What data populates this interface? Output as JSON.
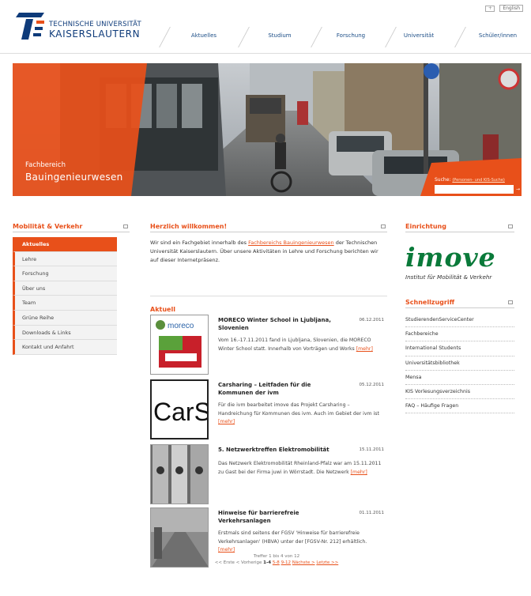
{
  "colors": {
    "accent": "#e8501a",
    "brand_blue": "#0e3b7a",
    "imove_green": "#0a7a3a"
  },
  "header": {
    "logo_line1": "Technische Universität",
    "logo_line2": "Kaiserslautern",
    "lang_plus": "+",
    "lang_label": "English",
    "nav": [
      "Aktuelles",
      "Studium",
      "Forschung",
      "Universität",
      "Schüler/innen"
    ]
  },
  "hero": {
    "label_line1": "Fachbereich",
    "label_line2": "Bauingenieurwesen",
    "search_label": "Suche:",
    "search_hint": "(Personen- und KIS-Suche)",
    "search_button": "→"
  },
  "sidebar": {
    "title": "Mobilität & Verkehr",
    "items": [
      {
        "label": "Aktuelles",
        "active": true
      },
      {
        "label": "Lehre"
      },
      {
        "label": "Forschung"
      },
      {
        "label": "Über uns"
      },
      {
        "label": "Team"
      },
      {
        "label": "Grüne Reihe"
      },
      {
        "label": "Downloads & Links"
      },
      {
        "label": "Kontakt und Anfahrt"
      }
    ]
  },
  "welcome": {
    "title": "Herzlich willkommen!",
    "text_before": "Wir sind ein Fachgebiet innerhalb des ",
    "link": "Fachbereichs Bauingenieurwesen",
    "text_after": " der Technischen Universität Kaiserslautern. Über unsere Aktivitäten in Lehre und Forschung berichten wir auf dieser Internetpräsenz."
  },
  "aktuell": {
    "title": "Aktuell",
    "more_label": "[mehr]",
    "news": [
      {
        "title": "MORECO Winter School in Ljubljana, Slovenien",
        "date": "06.12.2011",
        "text": "Vom 16.-17.11.2011 fand in Ljubljana, Slovenien, die MORECO Winter School statt. Innerhalb von Vorträgen und Works ",
        "thumb_word": "moreco"
      },
      {
        "title": "Carsharing – Leitfaden für die Kommunen der ivm",
        "date": "05.12.2011",
        "text": "Für die ivm bearbeitet imove das Projekt Carsharing – Handreichung für Kommunen des ivm. Auch im Gebiet der ivm ist ",
        "thumb_word": "CarS"
      },
      {
        "title": "5. Netzwerktreffen Elektromobilität",
        "date": "15.11.2011",
        "text": "Das Netzwerk Elektromobilität Rheinland-Pfalz war am 15.11.2011 zu Gast bei der Firma juwi in Wörrstadt. Die Netzwerk ",
        "thumb_word": ""
      },
      {
        "title": "Hinweise für barrierefreie Verkehrsanlagen",
        "date": "01.11.2011",
        "text": "Erstmals sind seitens der FGSV 'Hinweise für barrierefreie Verkehrsanlagen' (HBVA) unter der [FGSV-Nr. 212] erhältlich. ",
        "thumb_word": ""
      }
    ],
    "pager_count": "Treffer 1 bis 4 von 12",
    "pager_first": "<< Erste",
    "pager_prev": "< Vorherige",
    "pager_current": "1-4",
    "pager_p2": "5-8",
    "pager_p3": "9-12",
    "pager_next": "Nächste >",
    "pager_last": "Letzte >>"
  },
  "right": {
    "einrichtung_title": "Einrichtung",
    "imove_word": "imove",
    "imove_sub": "Institut für Mobilität & Verkehr",
    "quick_title": "Schnellzugriff",
    "quick_items": [
      "StudierendenServiceCenter",
      "Fachbereiche",
      "International Students",
      "Universitätsbibliothek",
      "Mensa",
      "KIS Vorlesungsverzeichnis",
      "FAQ – Häufige Fragen"
    ]
  }
}
